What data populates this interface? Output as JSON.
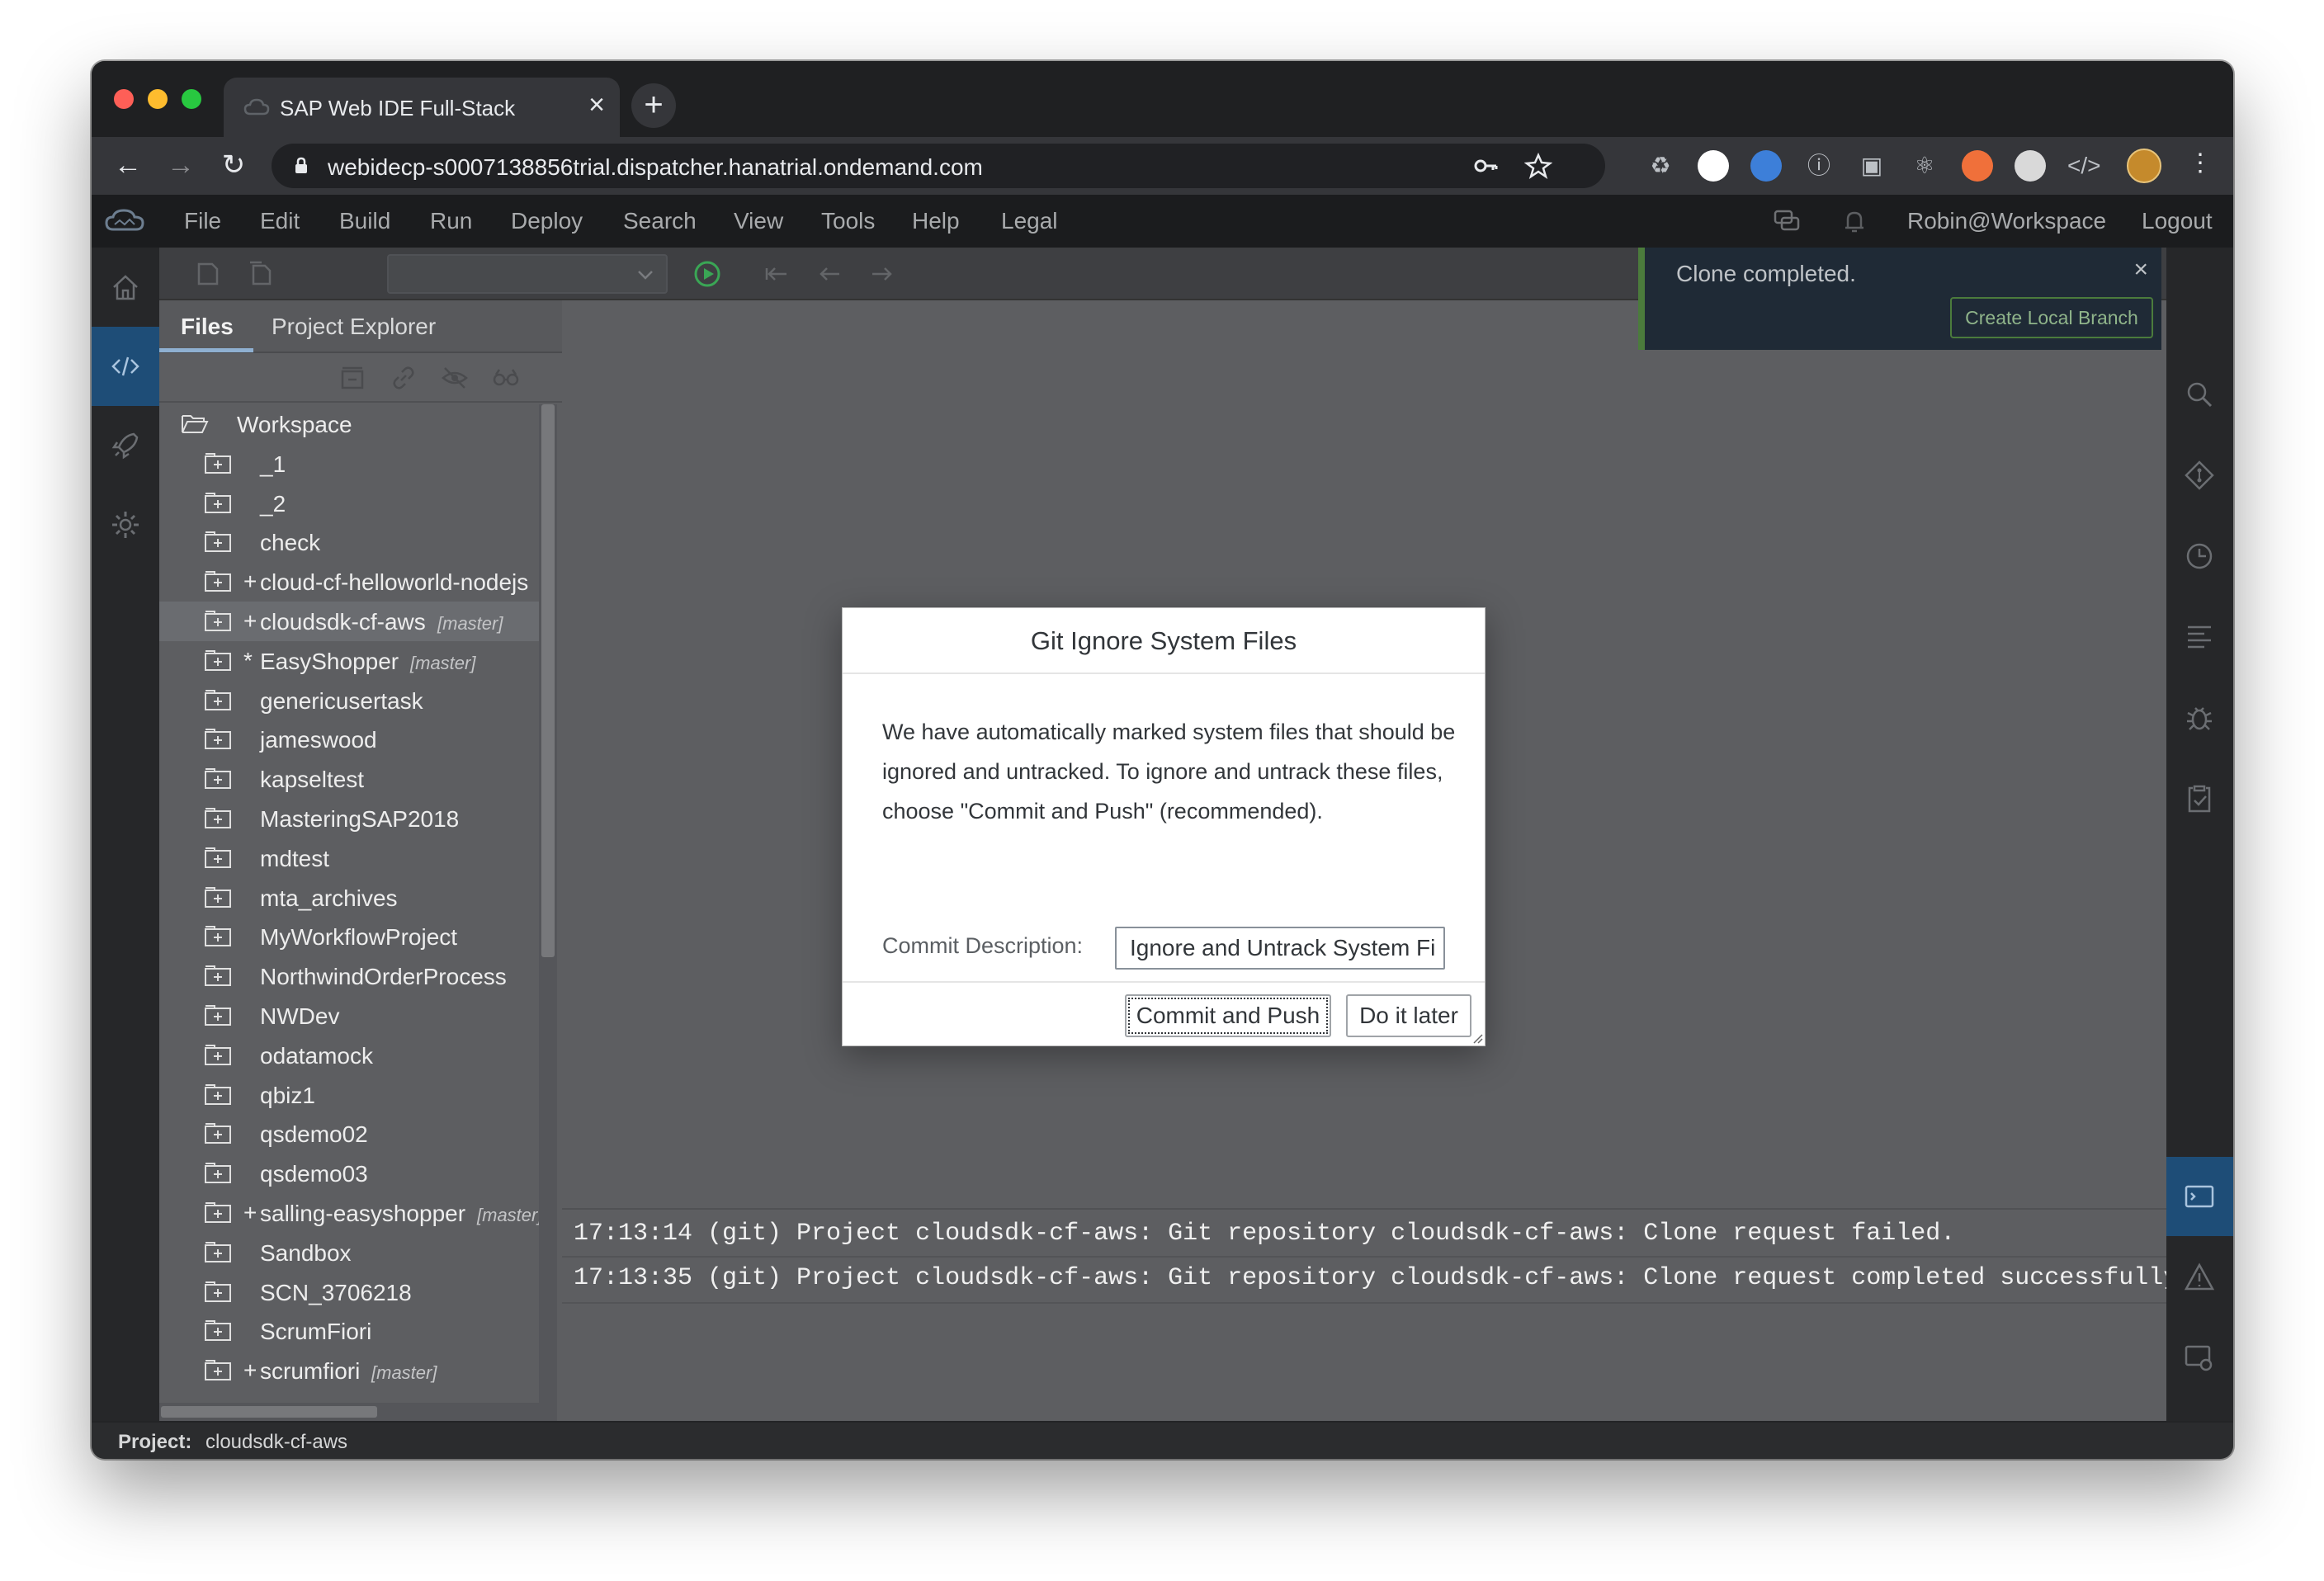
{
  "browser": {
    "tab_title": "SAP Web IDE Full-Stack",
    "tab_close": "×",
    "new_tab": "+",
    "url": "webidecp-s0007138856trial.dispatcher.hanatrial.ondemand.com",
    "icons": [
      "back-icon",
      "forward-icon",
      "reload-icon",
      "lock-icon",
      "key-icon",
      "star-icon",
      "extension-icons",
      "profile-avatar",
      "menu-kebab-icon"
    ]
  },
  "menubar": {
    "items": [
      "File",
      "Edit",
      "Build",
      "Run",
      "Deploy",
      "Search",
      "View",
      "Tools",
      "Help",
      "Legal"
    ],
    "user": "Robin@Workspace",
    "logout": "Logout"
  },
  "explorer": {
    "tabs": [
      "Files",
      "Project Explorer"
    ],
    "root": "Workspace",
    "items": [
      {
        "name": "_1",
        "mark": "",
        "branch": ""
      },
      {
        "name": "_2",
        "mark": "",
        "branch": ""
      },
      {
        "name": "check",
        "mark": "",
        "branch": ""
      },
      {
        "name": "cloud-cf-helloworld-nodejs",
        "mark": "+",
        "branch": ""
      },
      {
        "name": "cloudsdk-cf-aws",
        "mark": "+",
        "branch": "[master]"
      },
      {
        "name": "EasyShopper",
        "mark": "*",
        "branch": "[master]"
      },
      {
        "name": "genericusertask",
        "mark": "",
        "branch": ""
      },
      {
        "name": "jameswood",
        "mark": "",
        "branch": ""
      },
      {
        "name": "kapseltest",
        "mark": "",
        "branch": ""
      },
      {
        "name": "MasteringSAP2018",
        "mark": "",
        "branch": ""
      },
      {
        "name": "mdtest",
        "mark": "",
        "branch": ""
      },
      {
        "name": "mta_archives",
        "mark": "",
        "branch": ""
      },
      {
        "name": "MyWorkflowProject",
        "mark": "",
        "branch": ""
      },
      {
        "name": "NorthwindOrderProcess",
        "mark": "",
        "branch": ""
      },
      {
        "name": "NWDev",
        "mark": "",
        "branch": ""
      },
      {
        "name": "odatamock",
        "mark": "",
        "branch": ""
      },
      {
        "name": "qbiz1",
        "mark": "",
        "branch": ""
      },
      {
        "name": "qsdemo02",
        "mark": "",
        "branch": ""
      },
      {
        "name": "qsdemo03",
        "mark": "",
        "branch": ""
      },
      {
        "name": "salling-easyshopper",
        "mark": "+",
        "branch": "[master]"
      },
      {
        "name": "Sandbox",
        "mark": "",
        "branch": ""
      },
      {
        "name": "SCN_3706218",
        "mark": "",
        "branch": ""
      },
      {
        "name": "ScrumFiori",
        "mark": "",
        "branch": ""
      },
      {
        "name": "scrumfiori",
        "mark": "+",
        "branch": "[master]"
      }
    ],
    "selected_index": 4
  },
  "console": {
    "lines": [
      "17:13:14 (git) Project cloudsdk-cf-aws: Git repository cloudsdk-cf-aws: Clone request failed.",
      "17:13:35 (git) Project cloudsdk-cf-aws: Git repository cloudsdk-cf-aws: Clone request completed successfully."
    ]
  },
  "toast": {
    "message": "Clone completed.",
    "close": "×",
    "action": "Create Local Branch"
  },
  "dialog": {
    "title": "Git Ignore System Files",
    "message": "We have automatically marked system files that should be ignored and untracked. To ignore and untrack these files, choose \"Commit and Push\" (recommended).",
    "commit_label": "Commit Description:",
    "commit_value": "Ignore and Untrack System Fi",
    "primary_button": "Commit and Push",
    "secondary_button": "Do it later"
  },
  "statusbar": {
    "label": "Project:",
    "value": "cloudsdk-cf-aws"
  },
  "colors": {
    "accent_blue": "#1e4d77",
    "toast_green": "#4b7b3c",
    "run_green": "#3aa655"
  }
}
